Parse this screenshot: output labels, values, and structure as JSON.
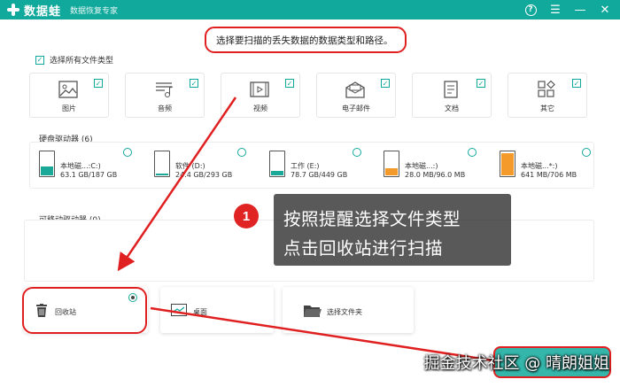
{
  "titlebar": {
    "app_name": "数据蛙",
    "subtitle": "数据恢复专家",
    "help_icon": "help-circle-icon",
    "menu_icon": "menu-icon",
    "minimize_icon": "minimize-icon",
    "close_icon": "close-icon",
    "color": "#11a99b"
  },
  "instruction": "选择要扫描的丢失数据的数据类型和路径。",
  "select_all": {
    "label": "选择所有文件类型",
    "checked": true
  },
  "file_types": [
    {
      "label": "图片",
      "icon": "image-icon",
      "checked": true
    },
    {
      "label": "音频",
      "icon": "music-icon",
      "checked": true
    },
    {
      "label": "视频",
      "icon": "video-icon",
      "checked": true
    },
    {
      "label": "电子邮件",
      "icon": "email-icon",
      "checked": true
    },
    {
      "label": "文档",
      "icon": "document-icon",
      "checked": true
    },
    {
      "label": "其它",
      "icon": "other-icon",
      "checked": true
    }
  ],
  "hard_drives": {
    "title": "硬盘驱动器 (6)",
    "items": [
      {
        "name": "本地磁...:C:)",
        "size": "63.1 GB/187 GB",
        "used_fraction": 0.34,
        "color": "#1aa898"
      },
      {
        "name": "软件 (D:)",
        "size": "24.4 GB/293 GB",
        "used_fraction": 0.08,
        "color": "#1aa898"
      },
      {
        "name": "工作 (E:)",
        "size": "78.7 GB/449 GB",
        "used_fraction": 0.18,
        "color": "#1aa898"
      },
      {
        "name": "本地磁...:)",
        "size": "28.0 MB/96.0 MB",
        "used_fraction": 0.29,
        "color": "#f39a2a"
      },
      {
        "name": "本地磁...*:)",
        "size": "641 MB/706 MB",
        "used_fraction": 0.91,
        "color": "#f39a2a"
      }
    ]
  },
  "removable": {
    "title": "可移动驱动器 (0)"
  },
  "locations": [
    {
      "label": "回收站",
      "icon": "recycle-bin-icon",
      "selected": true
    },
    {
      "label": "桌面",
      "icon": "desktop-icon",
      "selected": false
    },
    {
      "label": "选择文件夹",
      "icon": "folder-icon",
      "selected": false
    }
  ],
  "callout": {
    "number": "1",
    "line1": "按照提醒选择文件类型",
    "line2": "点击回收站进行扫描"
  },
  "watermark": "掘金技术社区 @ 晴朗姐姐",
  "annotation_color": "#e02020"
}
